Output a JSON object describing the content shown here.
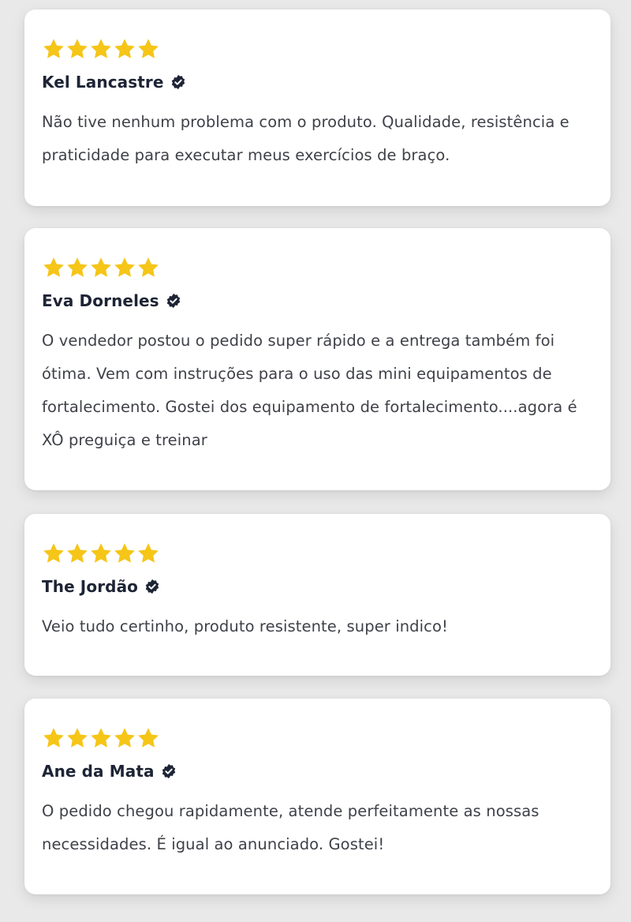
{
  "colors": {
    "background": "#e9e9e9",
    "card": "#ffffff",
    "star": "#f5c518",
    "name": "#1d2435",
    "text": "#3f4148",
    "verified_badge": "#1d2435"
  },
  "reviews": [
    {
      "rating": 5,
      "reviewer": "Kel Lancastre",
      "verified": true,
      "text": "Não tive nenhum problema com o produto. Qualidade, resistência e praticidade para executar meus exercícios de braço."
    },
    {
      "rating": 5,
      "reviewer": "Eva Dorneles",
      "verified": true,
      "text": "O vendedor postou o pedido super rápido e a entrega também foi ótima. Vem com instruções para o uso das mini equipamentos de fortalecimento. Gostei dos equipamento de fortalecimento....agora é XÔ preguiça e treinar"
    },
    {
      "rating": 5,
      "reviewer": "The Jordão",
      "verified": true,
      "text": "Veio tudo certinho, produto resistente, super indico!"
    },
    {
      "rating": 5,
      "reviewer": "Ane da Mata",
      "verified": true,
      "text": "O pedido chegou rapidamente, atende perfeitamente as nossas necessidades. É igual ao anunciado. Gostei!"
    }
  ]
}
